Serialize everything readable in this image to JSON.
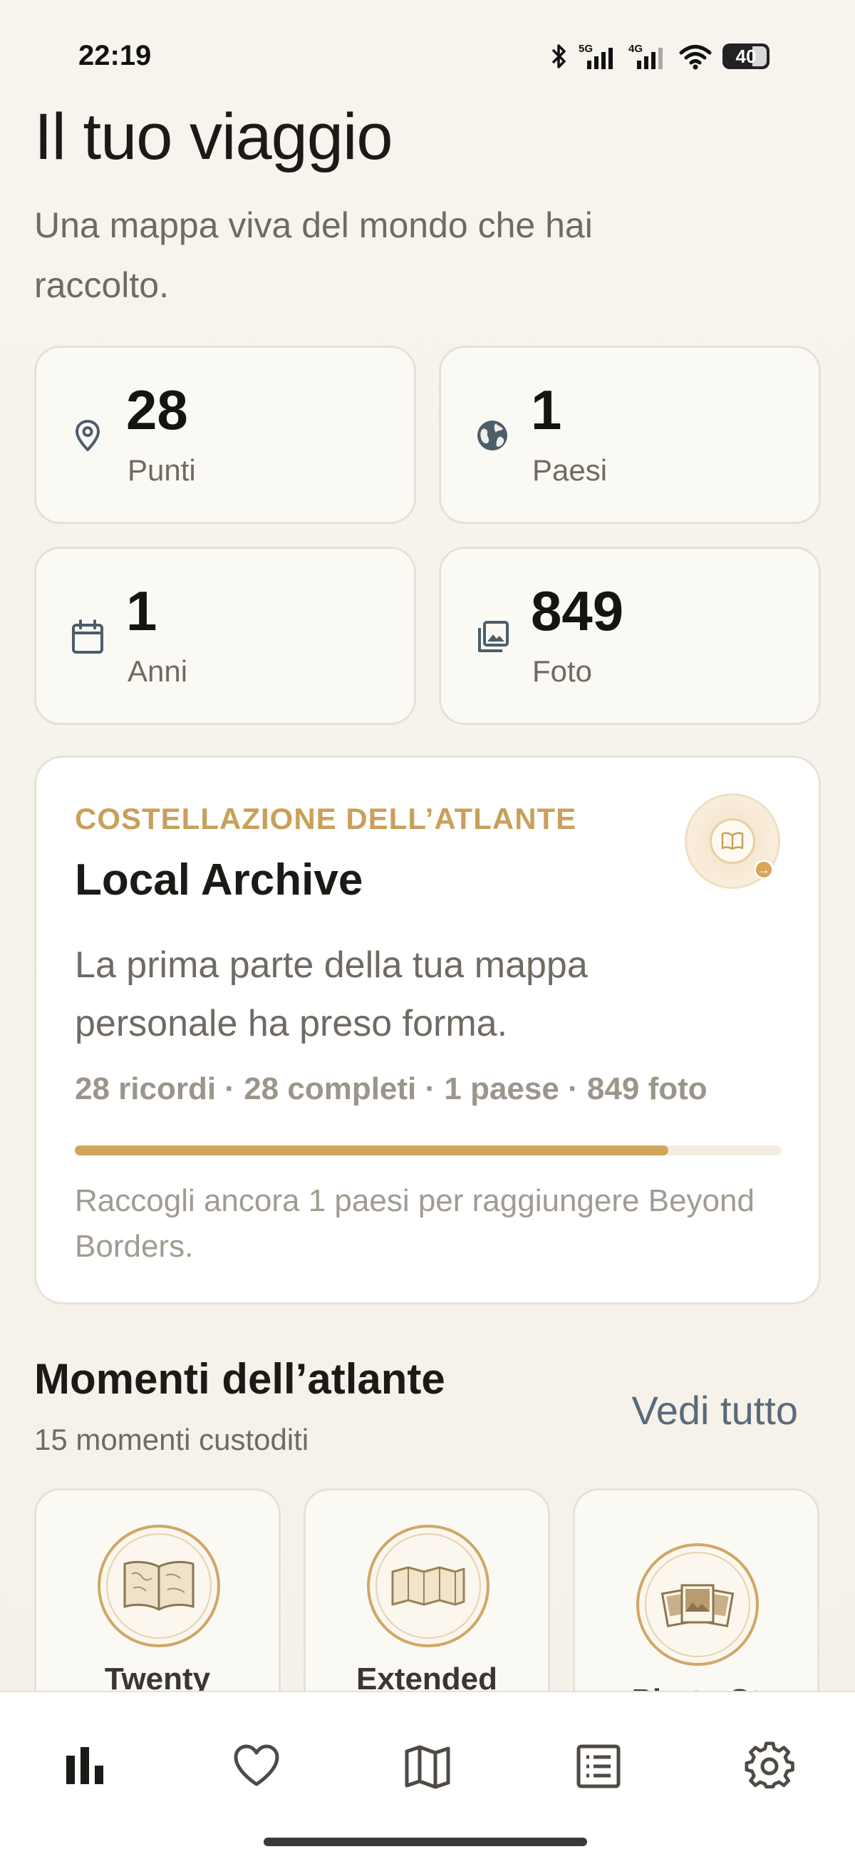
{
  "status_bar": {
    "time": "22:19",
    "battery": "40",
    "icons": [
      "bluetooth-icon",
      "signal-5g-icon",
      "signal-4g-icon",
      "wifi-icon",
      "battery-icon"
    ]
  },
  "header": {
    "title": "Il tuo viaggio",
    "subtitle": "Una mappa viva del mondo che hai raccolto."
  },
  "stats": [
    {
      "icon": "location-pin-icon",
      "value": "28",
      "label": "Punti"
    },
    {
      "icon": "globe-icon",
      "value": "1",
      "label": "Paesi"
    },
    {
      "icon": "calendar-icon",
      "value": "1",
      "label": "Anni"
    },
    {
      "icon": "photos-icon",
      "value": "849",
      "label": "Foto"
    }
  ],
  "atlas": {
    "eyebrow": "COSTELLAZIONE DELL’ATLANTE",
    "title": "Local Archive",
    "description": "La prima parte della tua mappa personale ha preso forma.",
    "stats_line": "28 ricordi · 28 completi · 1 paese · 849 foto",
    "progress": 0.84,
    "hint": "Raccogli ancora 1 paesi per raggiungere Beyond Borders.",
    "badge_icon": "open-book-icon",
    "colors": {
      "accent": "#d1a658",
      "eyebrow": "#c9a05a"
    }
  },
  "moments": {
    "title": "Momenti dell’atlante",
    "count": "15 momenti custoditi",
    "see_all": "Vedi tutto",
    "items": [
      {
        "label": "Twenty",
        "icon": "atlas-book-icon"
      },
      {
        "label": "Extended",
        "icon": "folded-map-icon"
      },
      {
        "label": "Photo St",
        "icon": "photo-stack-icon"
      }
    ]
  },
  "bottom_nav": {
    "items": [
      {
        "name": "stats",
        "icon": "bar-chart-icon",
        "active": true
      },
      {
        "name": "favorites",
        "icon": "heart-icon",
        "active": false
      },
      {
        "name": "map",
        "icon": "map-icon",
        "active": false
      },
      {
        "name": "list",
        "icon": "list-icon",
        "active": false
      },
      {
        "name": "settings",
        "icon": "gear-icon",
        "active": false
      }
    ]
  }
}
